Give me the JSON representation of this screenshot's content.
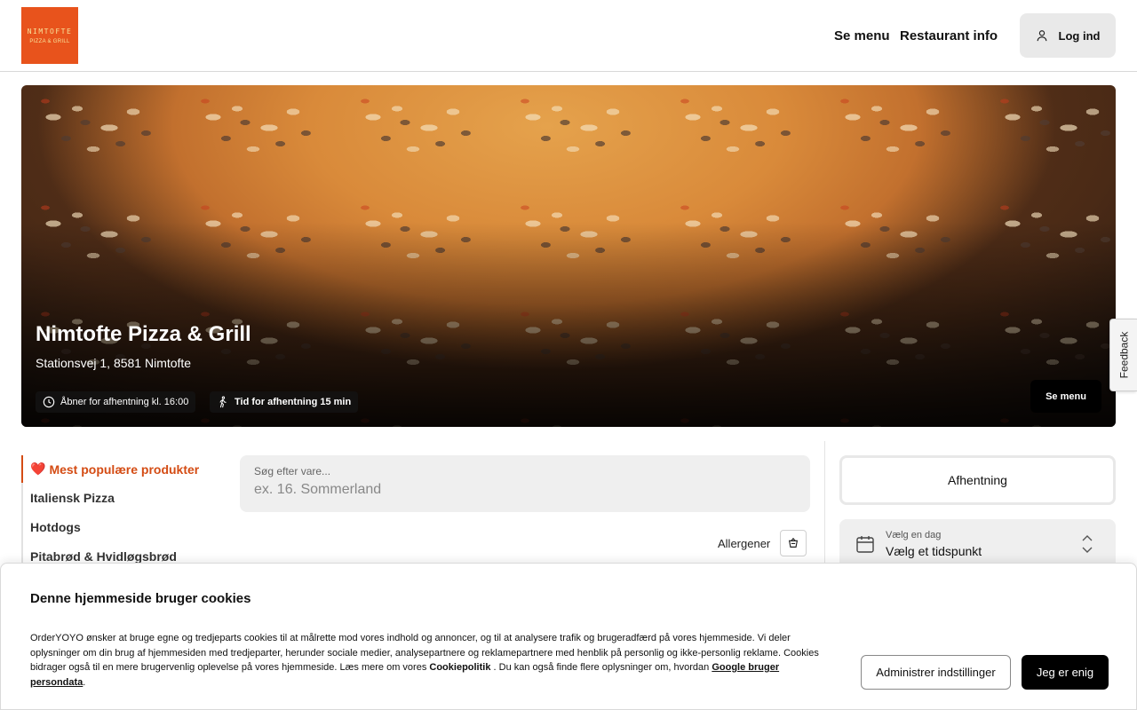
{
  "header": {
    "logo_line1": "NIMTOFTE",
    "logo_line2": "PIZZA & GRILL",
    "nav_menu": "Se menu",
    "nav_info": "Restaurant info",
    "login": "Log ind"
  },
  "hero": {
    "title": "Nimtofte Pizza & Grill",
    "address": "Stationsvej 1, 8581 Nimtofte",
    "open_chip": "Åbner for afhentning kl. 16:00",
    "pickup_chip": "Tid for afhentning 15 min",
    "menu_button": "Se menu"
  },
  "feedback": "Feedback",
  "categories": [
    {
      "label": "Mest populære produkter",
      "icon": "heart-icon",
      "active": true
    },
    {
      "label": "Italiensk Pizza"
    },
    {
      "label": "Hotdogs"
    },
    {
      "label": "Pitabrød & Hvidløgsbrød"
    }
  ],
  "search": {
    "label": "Søg efter vare...",
    "placeholder": "ex. 16. Sommerland"
  },
  "allergens": {
    "label": "Allergener",
    "icon": "allergen-icon"
  },
  "order": {
    "pickup": "Afhentning",
    "day_label": "Vælg en dag",
    "time_value": "Vælg et tidspunkt"
  },
  "cookie": {
    "title": "Denne hjemmeside bruger cookies",
    "text_part1": "OrderYOYO ønsker at bruge egne og tredjeparts cookies til at målrette mod vores indhold og annoncer, og til at analysere trafik og brugeradfærd på vores hjemmeside. Vi deler oplysninger om din brug af hjemmesiden med tredjeparter, herunder sociale medier, analysepartnere og reklamepartnere med henblik på personlig og ikke-personlig reklame. Cookies bidrager også til en mere brugervenlig oplevelse på vores hjemmeside. Læs mere om vores ",
    "policy_link": "Cookiepolitik",
    "text_part2": " . Du kan også finde flere oplysninger om, hvordan ",
    "google_link": "Google bruger persondata",
    "text_part3": ".",
    "settings_button": "Administrer indstillinger",
    "agree_button": "Jeg er enig"
  },
  "colors": {
    "logo_bg": "#e8531c",
    "accent": "#d44c14",
    "heart": "#d32a2a"
  }
}
